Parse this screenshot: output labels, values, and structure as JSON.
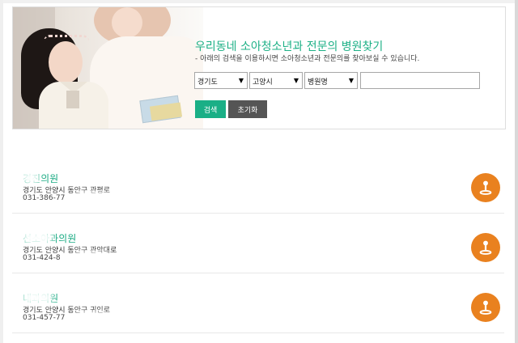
{
  "search": {
    "title": "우리동네 소아청소년과 전문의 병원찾기",
    "subtitle": "- 아래의 검색을 이용하시면 소아청소년과 전문의를 찾아보실 수 있습니다.",
    "selects": [
      {
        "value": "경기도"
      },
      {
        "value": "고양시"
      },
      {
        "value": "병원명"
      }
    ],
    "input_value": "",
    "search_button": "검색",
    "reset_button": "초기화"
  },
  "results": [
    {
      "name": "경진의원",
      "address": "경기도 안양시 동안구 관평로",
      "phone": "031-386-77"
    },
    {
      "name": "선소아과의원",
      "address": "경기도 안양시 동안구 관악대로",
      "phone": "031-424-8"
    },
    {
      "name": "내과의원",
      "address": "경기도 안양시 동안구 귀인로",
      "phone": "031-457-77"
    }
  ],
  "icons": {
    "location": "location-pin-icon"
  },
  "colors": {
    "accent": "#1aaf86",
    "location_button": "#e9811f",
    "reset_button": "#555555"
  }
}
